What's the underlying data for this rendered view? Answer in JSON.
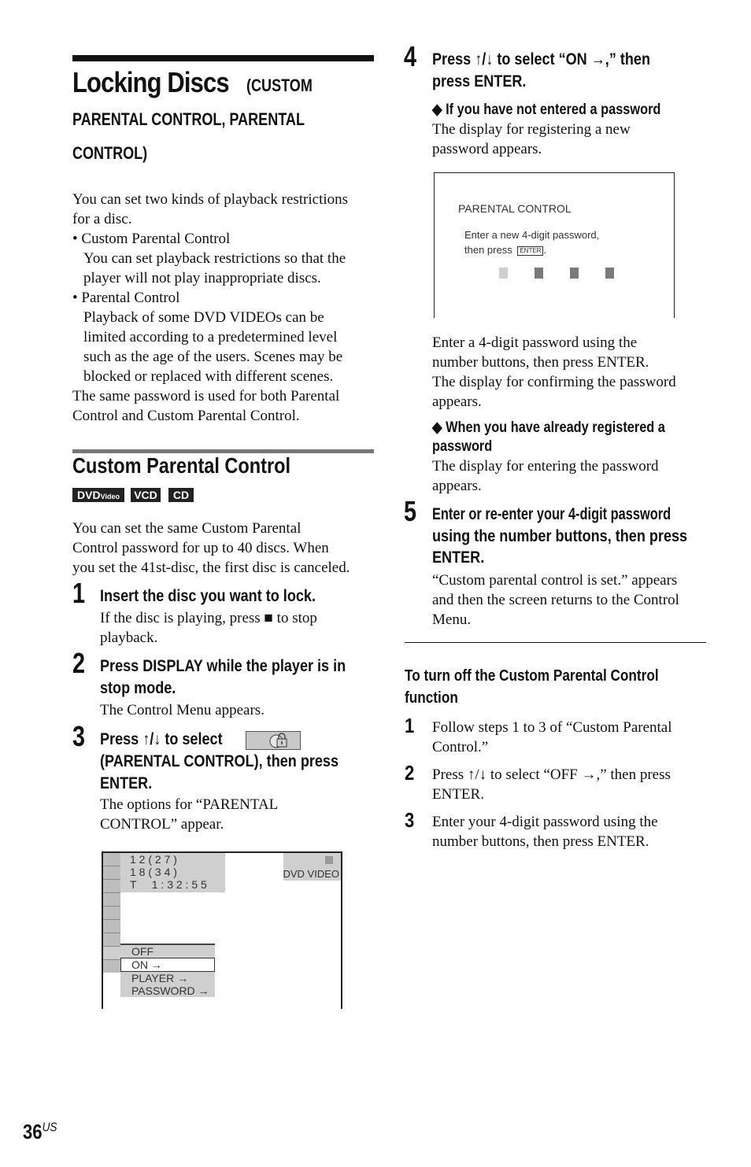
{
  "page": {
    "title_main": "Locking Discs",
    "title_sub_1": "(CUSTOM",
    "title_sub_2": "PARENTAL CONTROL, PARENTAL",
    "title_sub_3": "CONTROL)",
    "intro_lines": [
      "You can set two kinds of playback restrictions",
      "for a disc.",
      "• Custom Parental Control",
      "You can set playback restrictions so that the",
      "player will not play inappropriate discs.",
      "• Parental Control",
      "Playback of some DVD VIDEOs can be",
      "limited according to a predetermined level",
      "such as the age of the users. Scenes may be",
      "blocked or replaced with different scenes.",
      "The same password is used for both Parental",
      "Control and Custom Parental Control."
    ],
    "section_title": "Custom Parental Control",
    "disc_badges": [
      {
        "main": "DVD",
        "small": "Video"
      },
      {
        "main": "VCD",
        "small": ""
      },
      {
        "main": "CD",
        "small": ""
      }
    ],
    "section_intro": [
      "You can set the same Custom Parental",
      "Control password for up to 40 discs. When",
      "you set the 41st-disc, the first disc is canceled."
    ],
    "page_number": "36",
    "page_suffix": "US"
  },
  "steps": [
    {
      "num": "1",
      "title": [
        "Insert the disc you want to lock."
      ],
      "body": [
        "If the disc is playing, press ■ to stop",
        "playback."
      ]
    },
    {
      "num": "2",
      "title": [
        "Press DISPLAY while the player is in",
        "stop mode."
      ],
      "body": [
        "The Control Menu appears."
      ]
    },
    {
      "num": "3",
      "title": [
        "Press ↑/↓ to select",
        "(PARENTAL CONTROL), then press",
        "ENTER."
      ],
      "body": [
        "The options for “PARENTAL",
        "CONTROL” appear."
      ],
      "icon": "parental-lock-icon"
    },
    {
      "num": "4",
      "title": [
        "Press ↑/↓ to select “ON →,” then",
        "press ENTER."
      ],
      "sub1_title": "◆ If you have not entered a password",
      "sub1_body": [
        "The display for registering a new",
        "password appears."
      ],
      "after_screen": [
        "Enter a 4-digit password using the",
        "number buttons, then press ENTER.",
        "The display for confirming the password",
        "appears."
      ],
      "sub2_title": [
        "◆ When you have already registered a",
        "password"
      ],
      "sub2_body": [
        "The display for entering the password",
        "appears."
      ]
    },
    {
      "num": "5",
      "title": [
        "Enter or re-enter your 4-digit password",
        "using the number buttons, then press",
        "ENTER."
      ],
      "body": [
        "“Custom parental control is set.” appears",
        "and then the screen returns to the Control",
        "Menu."
      ]
    }
  ],
  "osd_menu": {
    "info": [
      "1 2 ( 2 7 )",
      "1 8 ( 3 4 )",
      "T     1 : 3 2 : 5 5"
    ],
    "disc_type": "DVD VIDEO",
    "options": [
      "OFF",
      "ON →",
      "PLAYER →",
      "PASSWORD →"
    ],
    "selected_option": "ON →"
  },
  "osd_password": {
    "title": "PARENTAL CONTROL",
    "line1": "Enter a new 4-digit password,",
    "line2": "then press",
    "enter_key": "ENTER",
    "line2_end": ".",
    "digits_total": 4,
    "digits_active": 1
  },
  "turn_off": {
    "title": [
      "To turn off the Custom Parental Control",
      "function"
    ],
    "steps": [
      {
        "num": "1",
        "text": [
          "Follow steps 1 to 3 of “Custom Parental",
          "Control.”"
        ]
      },
      {
        "num": "2",
        "text": [
          "Press ↑/↓ to select “OFF →,” then press",
          "ENTER."
        ]
      },
      {
        "num": "3",
        "text": [
          "Enter your 4-digit password using the",
          "number buttons, then press ENTER."
        ]
      }
    ]
  }
}
